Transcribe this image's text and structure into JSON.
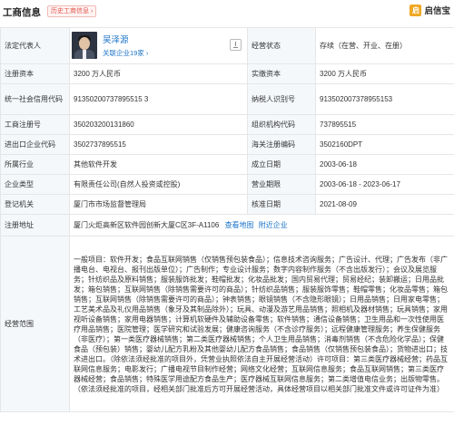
{
  "header": {
    "title": "工商信息",
    "history_tag": "历史工商信息 ›",
    "brand_logo": "启",
    "brand_name": "启信宝"
  },
  "rep": {
    "label": "法定代表人",
    "name": "吴泽源",
    "sub": "关联企业19家 ›"
  },
  "rows": {
    "status_label": "经营状态",
    "status_value": "存续（在营、开业、在册）",
    "reg_capital_label": "注册资本",
    "reg_capital_value": "3200 万人民币",
    "paid_capital_label": "实缴资本",
    "paid_capital_value": "3200 万人民币",
    "credit_label": "统一社会信用代码",
    "credit_value": "91350200737895515 3",
    "taxpayer_label": "纳税人识别号",
    "taxpayer_value": "913502007378955153",
    "regno_label": "工商注册号",
    "regno_value": "350203200131860",
    "org_label": "组织机构代码",
    "org_value": "737895515",
    "ie_label": "进出口企业代码",
    "ie_value": "3502737895515",
    "customs_label": "海关注册编码",
    "customs_value": "3502160DPT",
    "industry_label": "所属行业",
    "industry_value": "其他软件开发",
    "founded_label": "成立日期",
    "founded_value": "2003-06-18",
    "type_label": "企业类型",
    "type_value": "有限责任公司(自然人投资或控股)",
    "term_label": "营业期限",
    "term_value": "2003-06-18 - 2023-06-17",
    "authority_label": "登记机关",
    "authority_value": "厦门市市场监督管理局",
    "approved_label": "核准日期",
    "approved_value": "2021-08-09",
    "address_label": "注册地址",
    "address_value": "厦门火炬高新区软件园创新大厦C区3F-A1106",
    "map_link": "查看地图",
    "nearby_link": "附近企业",
    "scope_label": "经营范围",
    "scope_value": "一般项目：软件开发；食品互联网销售（仅销售预包装食品）；信息技术咨询服务；广告设计、代理；广告发布（非广播电台、电视台、报刊出版单位）；广告制作；专业设计服务；数字内容制作服务（不含出版发行）；会议及展览服务；针纺织品及原料销售；服装服饰批发；鞋帽批发；化妆品批发；国内贸易代理；贸易经纪；装卸搬运；日用品批发；箱包销售；互联网销售（除销售需要许可的商品）；针纺织品销售；服装服饰零售；鞋帽零售；化妆品零售；箱包销售；互联网销售（除销售需要许可的商品）；钟表销售；眼镜销售（不含隐形眼镜）；日用品销售；日用家电零售；工艺美术品及礼仪用品销售（象牙及其制品除外）；玩具、动漫及游艺用品销售；照相机及器材销售；玩具销售；家用视听设备销售；家用电器销售；计算机软硬件及辅助设备零售；软件销售；通信设备销售；卫生用品和一次性使用医疗用品销售；医院管理；医学研究和试验发展；健康咨询服务（不含诊疗服务）；远程健康管理服务；养生保健服务（非医疗）；第一类医疗器械销售；第二类医疗器械销售；个人卫生用品销售；消毒剂销售（不含危险化学品）；保健食品（预包装）销售；婴幼儿配方乳粉及其他婴幼儿配方食品销售；食品销售（仅销售预包装食品）；货物进出口；技术进出口。（除依法须经批准的项目外，凭营业执照依法自主开展经营活动）许可项目：第三类医疗器械经营；药品互联网信息服务；电影发行；广播电视节目制作经营；网络文化经营；互联网信息服务；食品互联网销售；第三类医疗器械经营；食品销售；特殊医学用途配方食品生产；医疗器械互联网信息服务；第二类增值电信业务；出版物零售。（依法须经批准的项目，经相关部门批准后方可开展经营活动，具体经营项目以相关部门批准文件或许可证件为准）"
  }
}
